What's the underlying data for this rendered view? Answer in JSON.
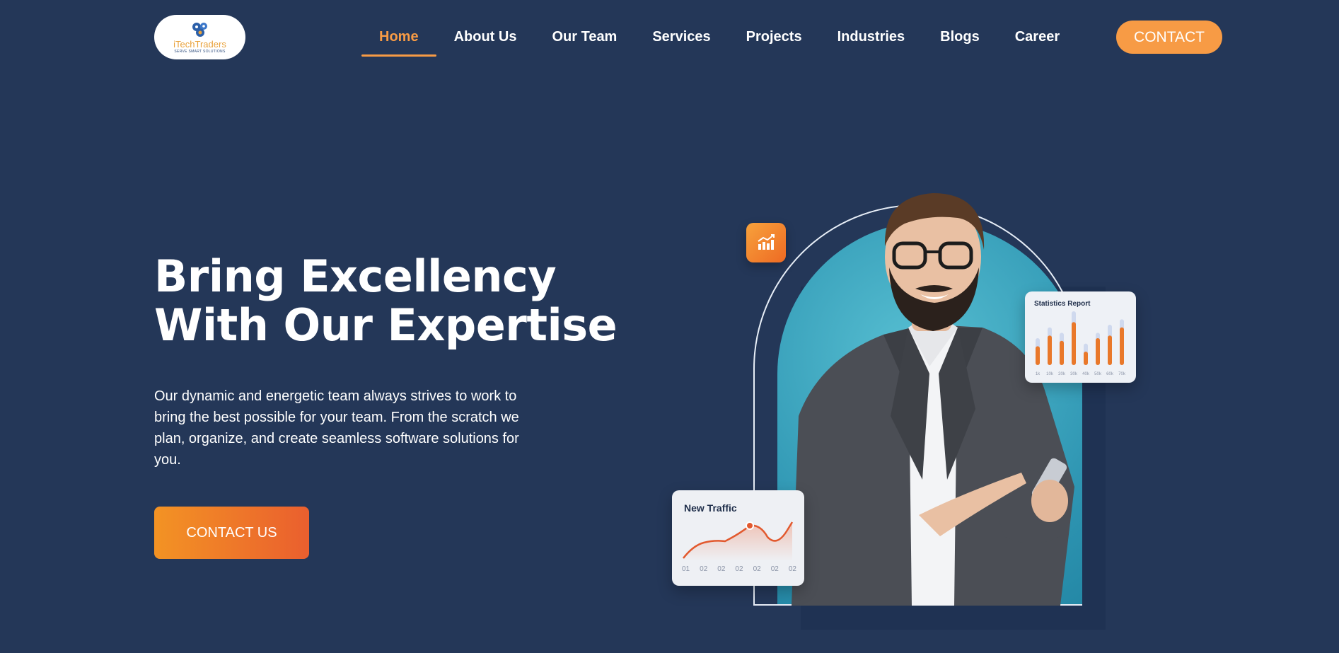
{
  "header": {
    "logo": {
      "name": "iTechTraders",
      "tagline": "SERVE SMART SOLUTIONS"
    },
    "nav": [
      {
        "label": "Home",
        "active": true
      },
      {
        "label": "About Us",
        "active": false
      },
      {
        "label": "Our Team",
        "active": false
      },
      {
        "label": "Services",
        "active": false
      },
      {
        "label": "Projects",
        "active": false
      },
      {
        "label": "Industries",
        "active": false
      },
      {
        "label": "Blogs",
        "active": false
      },
      {
        "label": "Career",
        "active": false
      }
    ],
    "contact_label": "CONTACT"
  },
  "hero": {
    "title": "Bring Excellency With Our Expertise",
    "description": "Our dynamic and energetic team always strives to work to bring the best possible for your team. From the scratch we plan, organize, and create seamless software solutions for you.",
    "cta_label": "CONTACT US"
  },
  "illustration": {
    "icon": "chart-growth-icon",
    "stats_card": {
      "title": "Statistics Report",
      "labels": [
        "1k",
        "10k",
        "20k",
        "30k",
        "40k",
        "50k",
        "60k",
        "70k"
      ],
      "values": [
        0.35,
        0.55,
        0.45,
        0.8,
        0.25,
        0.5,
        0.55,
        0.7
      ],
      "max": [
        0.5,
        0.7,
        0.6,
        1.0,
        0.4,
        0.6,
        0.75,
        0.85
      ]
    },
    "traffic_card": {
      "title": "New Traffic",
      "labels": [
        "01",
        "02",
        "02",
        "02",
        "02",
        "02",
        "02"
      ]
    }
  },
  "colors": {
    "background": "#243758",
    "accent": "#f79b45",
    "cta_gradient_start": "#f39324",
    "cta_gradient_end": "#ea5f2e",
    "arch": "#3aa8c2"
  }
}
